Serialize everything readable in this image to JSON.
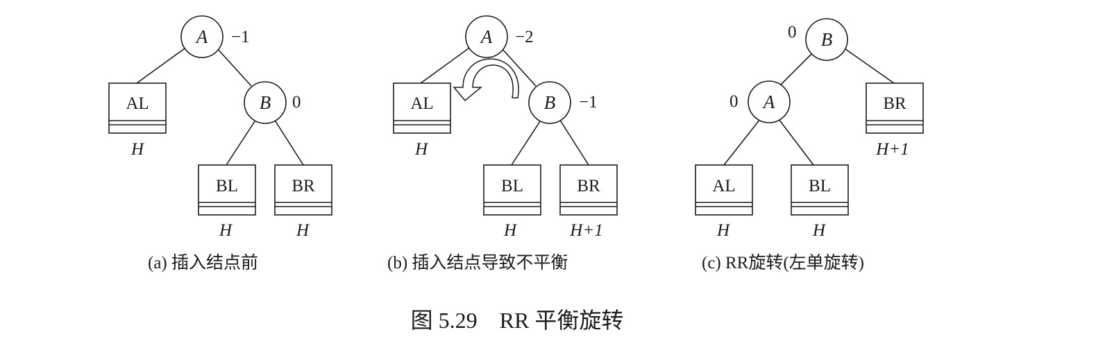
{
  "panels": [
    {
      "id": "a",
      "caption": "(a) 插入结点前",
      "nodes": [
        {
          "label": "A",
          "bf": "−1"
        },
        {
          "label": "B",
          "bf": "0"
        }
      ],
      "boxes": [
        {
          "label": "AL",
          "height": "H"
        },
        {
          "label": "BL",
          "height": "H"
        },
        {
          "label": "BR",
          "height": "H"
        }
      ]
    },
    {
      "id": "b",
      "caption": "(b) 插入结点导致不平衡",
      "nodes": [
        {
          "label": "A",
          "bf": "−2"
        },
        {
          "label": "B",
          "bf": "−1"
        }
      ],
      "boxes": [
        {
          "label": "AL",
          "height": "H"
        },
        {
          "label": "BL",
          "height": "H"
        },
        {
          "label": "BR",
          "height": "H+1"
        }
      ]
    },
    {
      "id": "c",
      "caption": "(c) RR旋转(左单旋转)",
      "nodes": [
        {
          "label": "B",
          "bf": "0"
        },
        {
          "label": "A",
          "bf": "0"
        }
      ],
      "boxes": [
        {
          "label": "BR",
          "height": "H+1"
        },
        {
          "label": "AL",
          "height": "H"
        },
        {
          "label": "BL",
          "height": "H"
        }
      ]
    }
  ],
  "figure_title": "图 5.29    RR 平衡旋转"
}
